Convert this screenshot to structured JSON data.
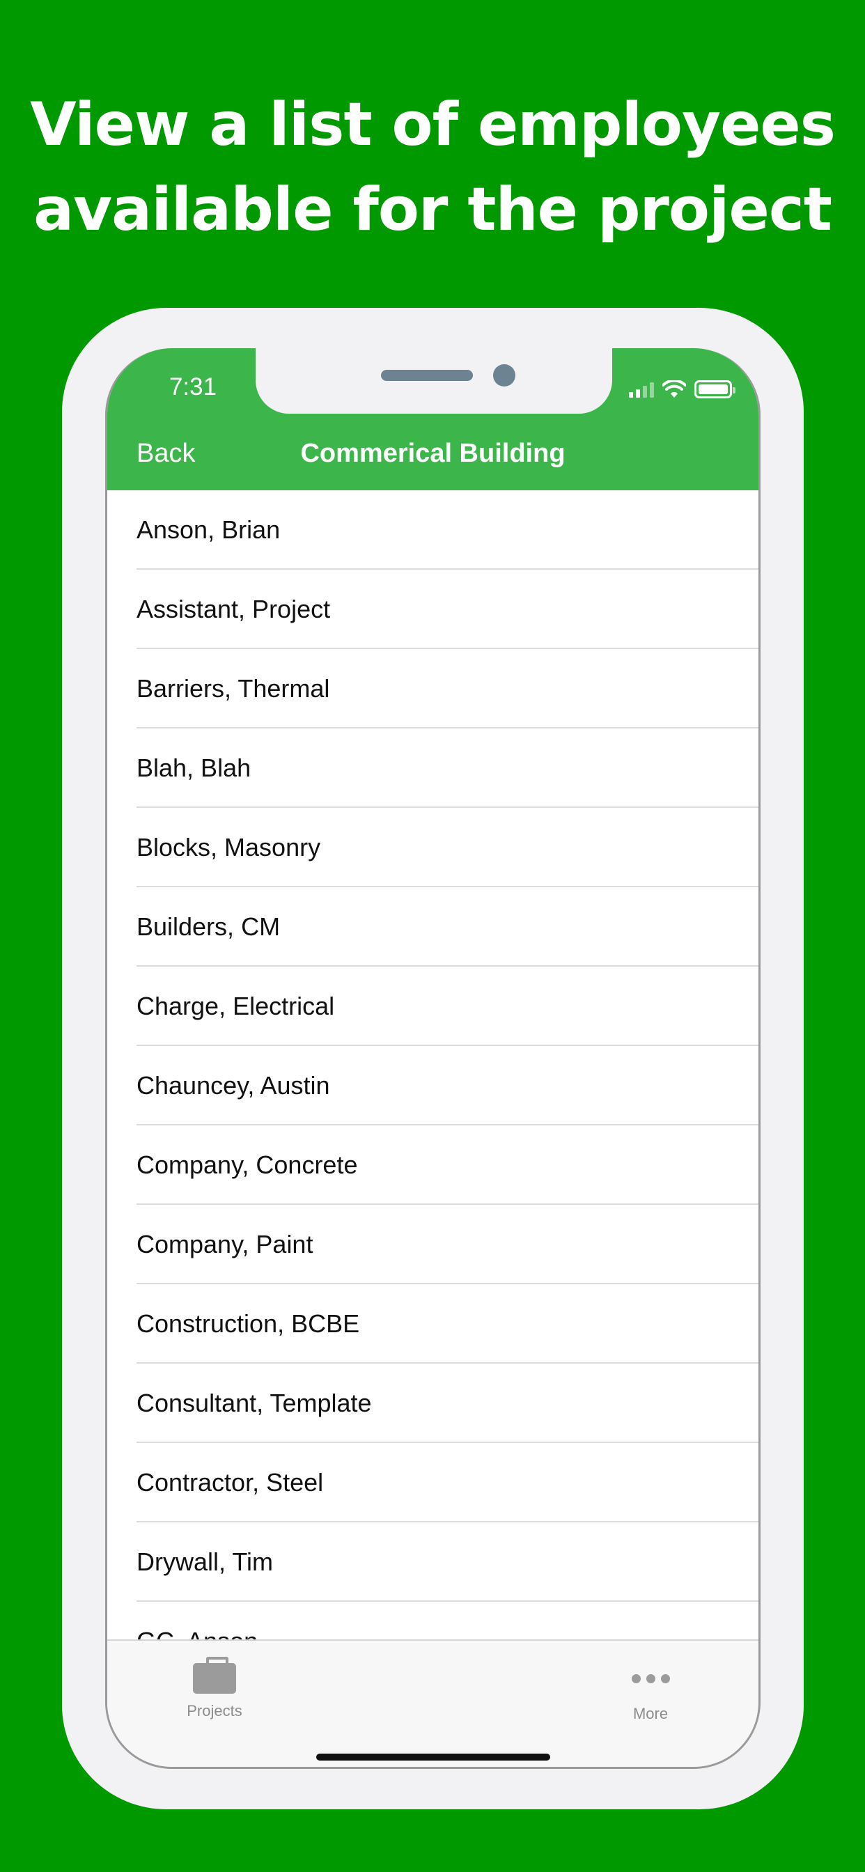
{
  "headline": {
    "line1": "View a list of employees",
    "line2": "available for the project"
  },
  "status_bar": {
    "time": "7:31",
    "icons": [
      "cellular-signal-icon",
      "wifi-icon",
      "battery-icon"
    ]
  },
  "nav": {
    "back_label": "Back",
    "title": "Commerical Building"
  },
  "employees": [
    "Anson, Brian",
    "Assistant, Project",
    "Barriers, Thermal",
    "Blah, Blah",
    "Blocks, Masonry",
    "Builders, CM",
    "Charge, Electrical",
    "Chauncey, Austin",
    "Company, Concrete",
    "Company, Paint",
    "Construction, BCBE",
    "Consultant, Template",
    "Contractor, Steel",
    "Drywall, Tim",
    "GC, Anson"
  ],
  "tabbar": {
    "projects_label": "Projects",
    "more_label": "More",
    "icons": [
      "briefcase-icon",
      "more-dots-icon"
    ]
  },
  "colors": {
    "background": "#009900",
    "nav_bar": "#3cb54a",
    "tab_inactive": "#8c8c8c"
  }
}
